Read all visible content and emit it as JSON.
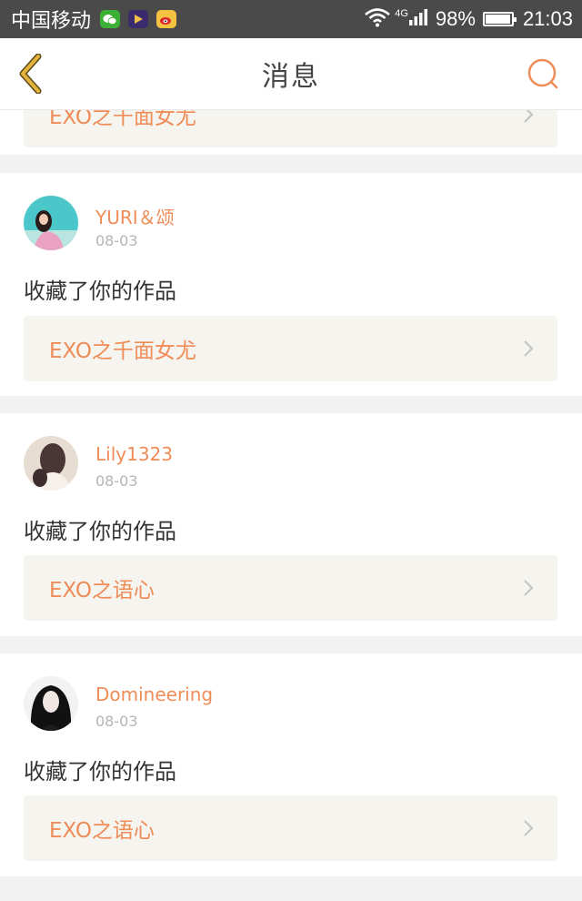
{
  "status_bar": {
    "carrier": "中国移动",
    "network": "4G",
    "battery": "98%",
    "battery_level": 0.98,
    "time": "21:03",
    "icons": [
      "wechat-icon",
      "video-app-icon",
      "weibo-icon",
      "wifi-icon",
      "signal-icon",
      "battery-icon"
    ]
  },
  "header": {
    "title": "消息",
    "back_icon": "chevron-left-icon",
    "search_icon": "search-icon"
  },
  "colors": {
    "accent": "#f08c57",
    "back_icon": "#e3b23c",
    "card_bg": "#ffffff",
    "page_bg": "#f2f2f2",
    "link_bg": "#f5f4ef"
  },
  "partial_top": {
    "work_title": "EXO之千面女尤"
  },
  "messages": [
    {
      "user": "YURI＆颂",
      "date": "08-03",
      "action": "收藏了你的作品",
      "work_title": "EXO之千面女尤"
    },
    {
      "user": "Lily1323",
      "date": "08-03",
      "action": "收藏了你的作品",
      "work_title": "EXO之语心"
    },
    {
      "user": "Domineering",
      "date": "08-03",
      "action": "收藏了你的作品",
      "work_title": "EXO之语心"
    }
  ]
}
